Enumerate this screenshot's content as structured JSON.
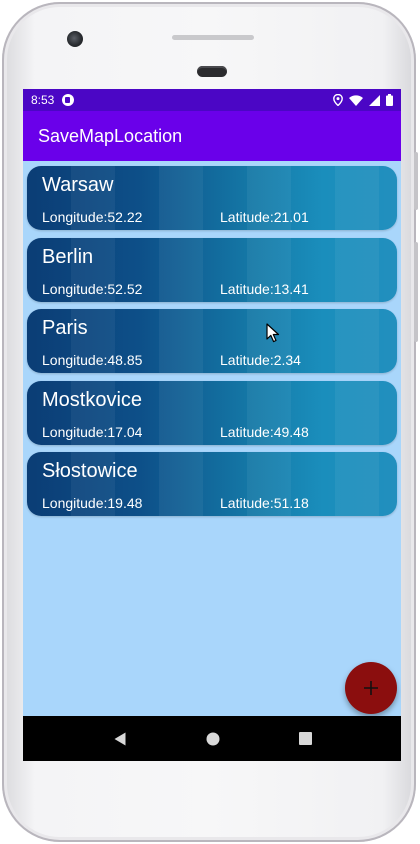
{
  "status_bar": {
    "time": "8:53",
    "icons": [
      "app-notification-icon",
      "location-icon",
      "wifi-icon",
      "signal-icon",
      "battery-icon"
    ]
  },
  "app_bar": {
    "title": "SaveMapLocation"
  },
  "locations": [
    {
      "name": "Warsaw",
      "longitude": "Longitude:52.22",
      "latitude": "Latitude:21.01"
    },
    {
      "name": "Berlin",
      "longitude": "Longitude:52.52",
      "latitude": "Latitude:13.41"
    },
    {
      "name": "Paris",
      "longitude": "Longitude:48.85",
      "latitude": "Latitude:2.34"
    },
    {
      "name": "Mostkovice",
      "longitude": "Longitude:17.04",
      "latitude": "Latitude:49.48"
    },
    {
      "name": "Słostowice",
      "longitude": "Longitude:19.48",
      "latitude": "Latitude:51.18"
    }
  ],
  "fab": {
    "icon": "plus-icon"
  },
  "nav_bar": {
    "icons": [
      "back-icon",
      "home-icon",
      "recents-icon"
    ]
  },
  "colors": {
    "status_bar": "#4b06c5",
    "app_bar": "#6a00ea",
    "background": "#a9d6fb",
    "fab": "#8b0e0e"
  }
}
